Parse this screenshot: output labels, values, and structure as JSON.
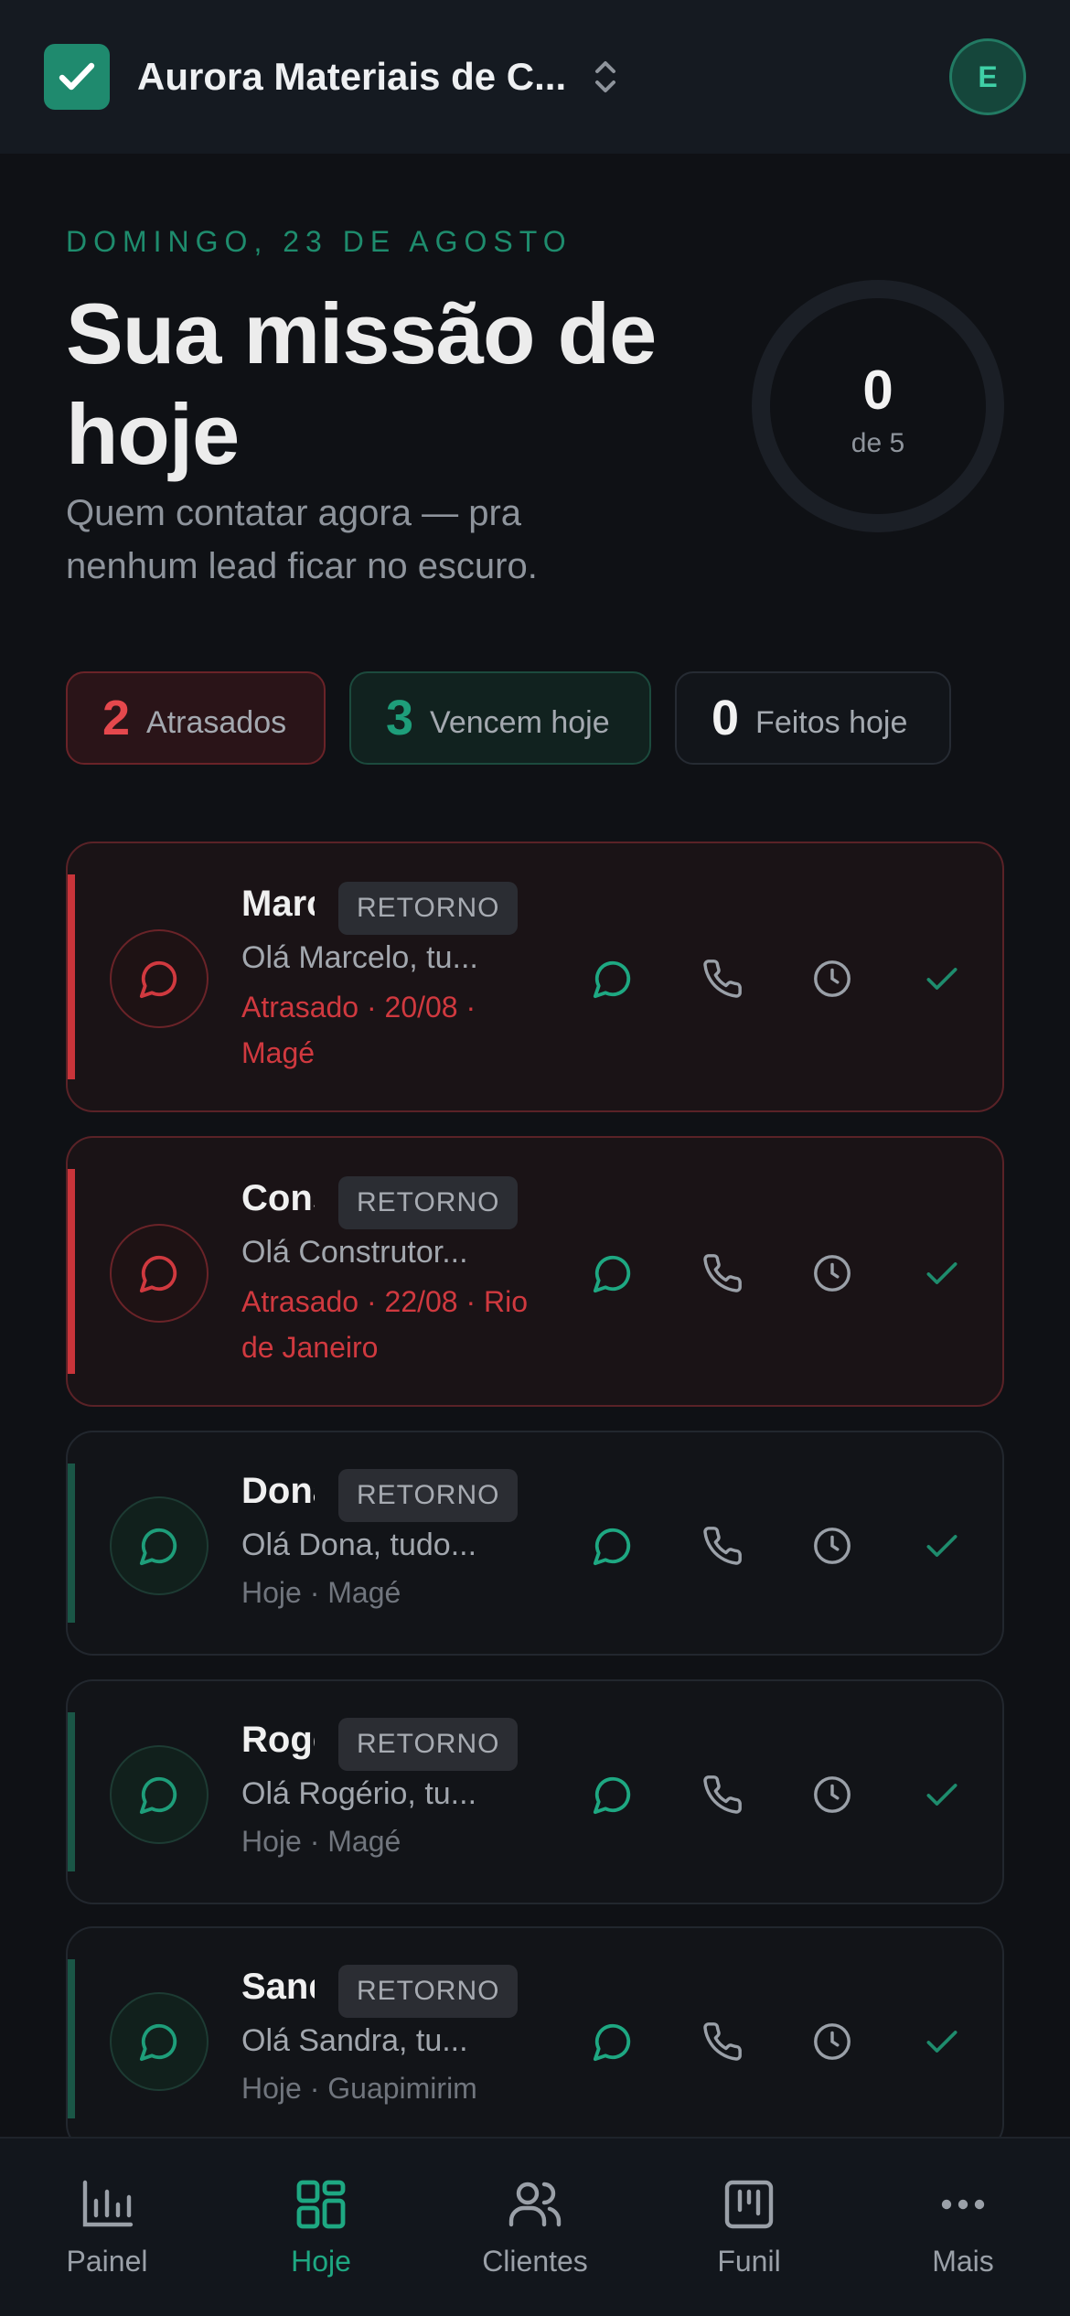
{
  "header": {
    "org_name": "Aurora Materiais de C...",
    "avatar_initial": "E"
  },
  "hero": {
    "date": "DOMINGO, 23 DE AGOSTO",
    "title": "Sua missão de hoje",
    "subtitle": "Quem contatar agora — pra nenhum lead ficar no escuro.",
    "progress": {
      "done": "0",
      "total_label": "de 5",
      "fraction": 0
    }
  },
  "stats": {
    "late": {
      "count": "2",
      "label": "Atrasados"
    },
    "due": {
      "count": "3",
      "label": "Vencem hoje"
    },
    "done": {
      "count": "0",
      "label": "Feitos hoje"
    }
  },
  "tasks": [
    {
      "name": "Marcelo",
      "tag": "RETORNO",
      "message": "Olá Marcelo, tu...",
      "meta": "Atrasado · 20/08 · Magé",
      "status": "late"
    },
    {
      "name": "Construtora",
      "tag": "RETORNO",
      "message": "Olá Construtor...",
      "meta": "Atrasado · 22/08 · Rio de Janeiro",
      "status": "late"
    },
    {
      "name": "Dona",
      "tag": "RETORNO",
      "message": "Olá Dona, tudo...",
      "meta": "Hoje · Magé",
      "status": "today"
    },
    {
      "name": "Rogério",
      "tag": "RETORNO",
      "message": "Olá Rogério, tu...",
      "meta": "Hoje · Magé",
      "status": "today"
    },
    {
      "name": "Sandra",
      "tag": "RETORNO",
      "message": "Olá Sandra, tu...",
      "meta": "Hoje · Guapimirim",
      "status": "today"
    }
  ],
  "nav": {
    "items": [
      {
        "label": "Painel",
        "icon": "chart-icon"
      },
      {
        "label": "Hoje",
        "icon": "grid-icon",
        "active": true
      },
      {
        "label": "Clientes",
        "icon": "users-icon"
      },
      {
        "label": "Funil",
        "icon": "kanban-icon"
      },
      {
        "label": "Mais",
        "icon": "more-icon"
      }
    ]
  },
  "colors": {
    "accent": "#1ea882",
    "danger": "#e5484d",
    "background": "#0f1115"
  }
}
